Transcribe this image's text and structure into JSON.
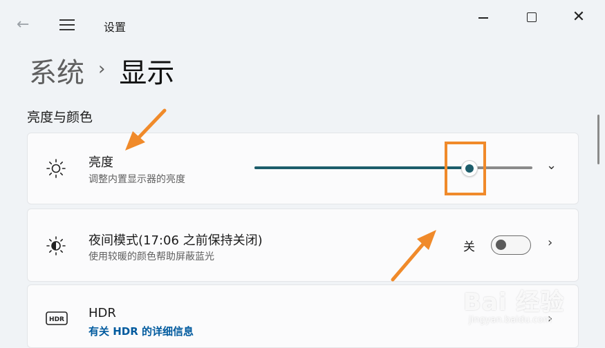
{
  "window": {
    "app_title": "设置",
    "back_icon": "back-arrow-icon",
    "menu_icon": "hamburger-icon"
  },
  "breadcrumb": {
    "parent": "系统",
    "separator": "›",
    "current": "显示"
  },
  "section": {
    "title": "亮度与颜色"
  },
  "brightness": {
    "icon": "sun-icon",
    "title": "亮度",
    "subtitle": "调整内置显示器的亮度",
    "value_fraction": 0.77,
    "accent_color": "#1d5d6b"
  },
  "night_light": {
    "icon": "night-light-icon",
    "title": "夜间模式(17:06 之前保持关闭)",
    "subtitle": "使用较暖的颜色帮助屏蔽蓝光",
    "toggle_label": "关",
    "toggle_on": false
  },
  "hdr": {
    "icon": "hdr-icon",
    "title": "HDR",
    "link": "有关 HDR 的详细信息"
  },
  "annotation": {
    "highlight_color": "#f08a2a"
  },
  "watermark": {
    "brand": "Bai 经验",
    "url": "jingyan.baidu.com"
  }
}
